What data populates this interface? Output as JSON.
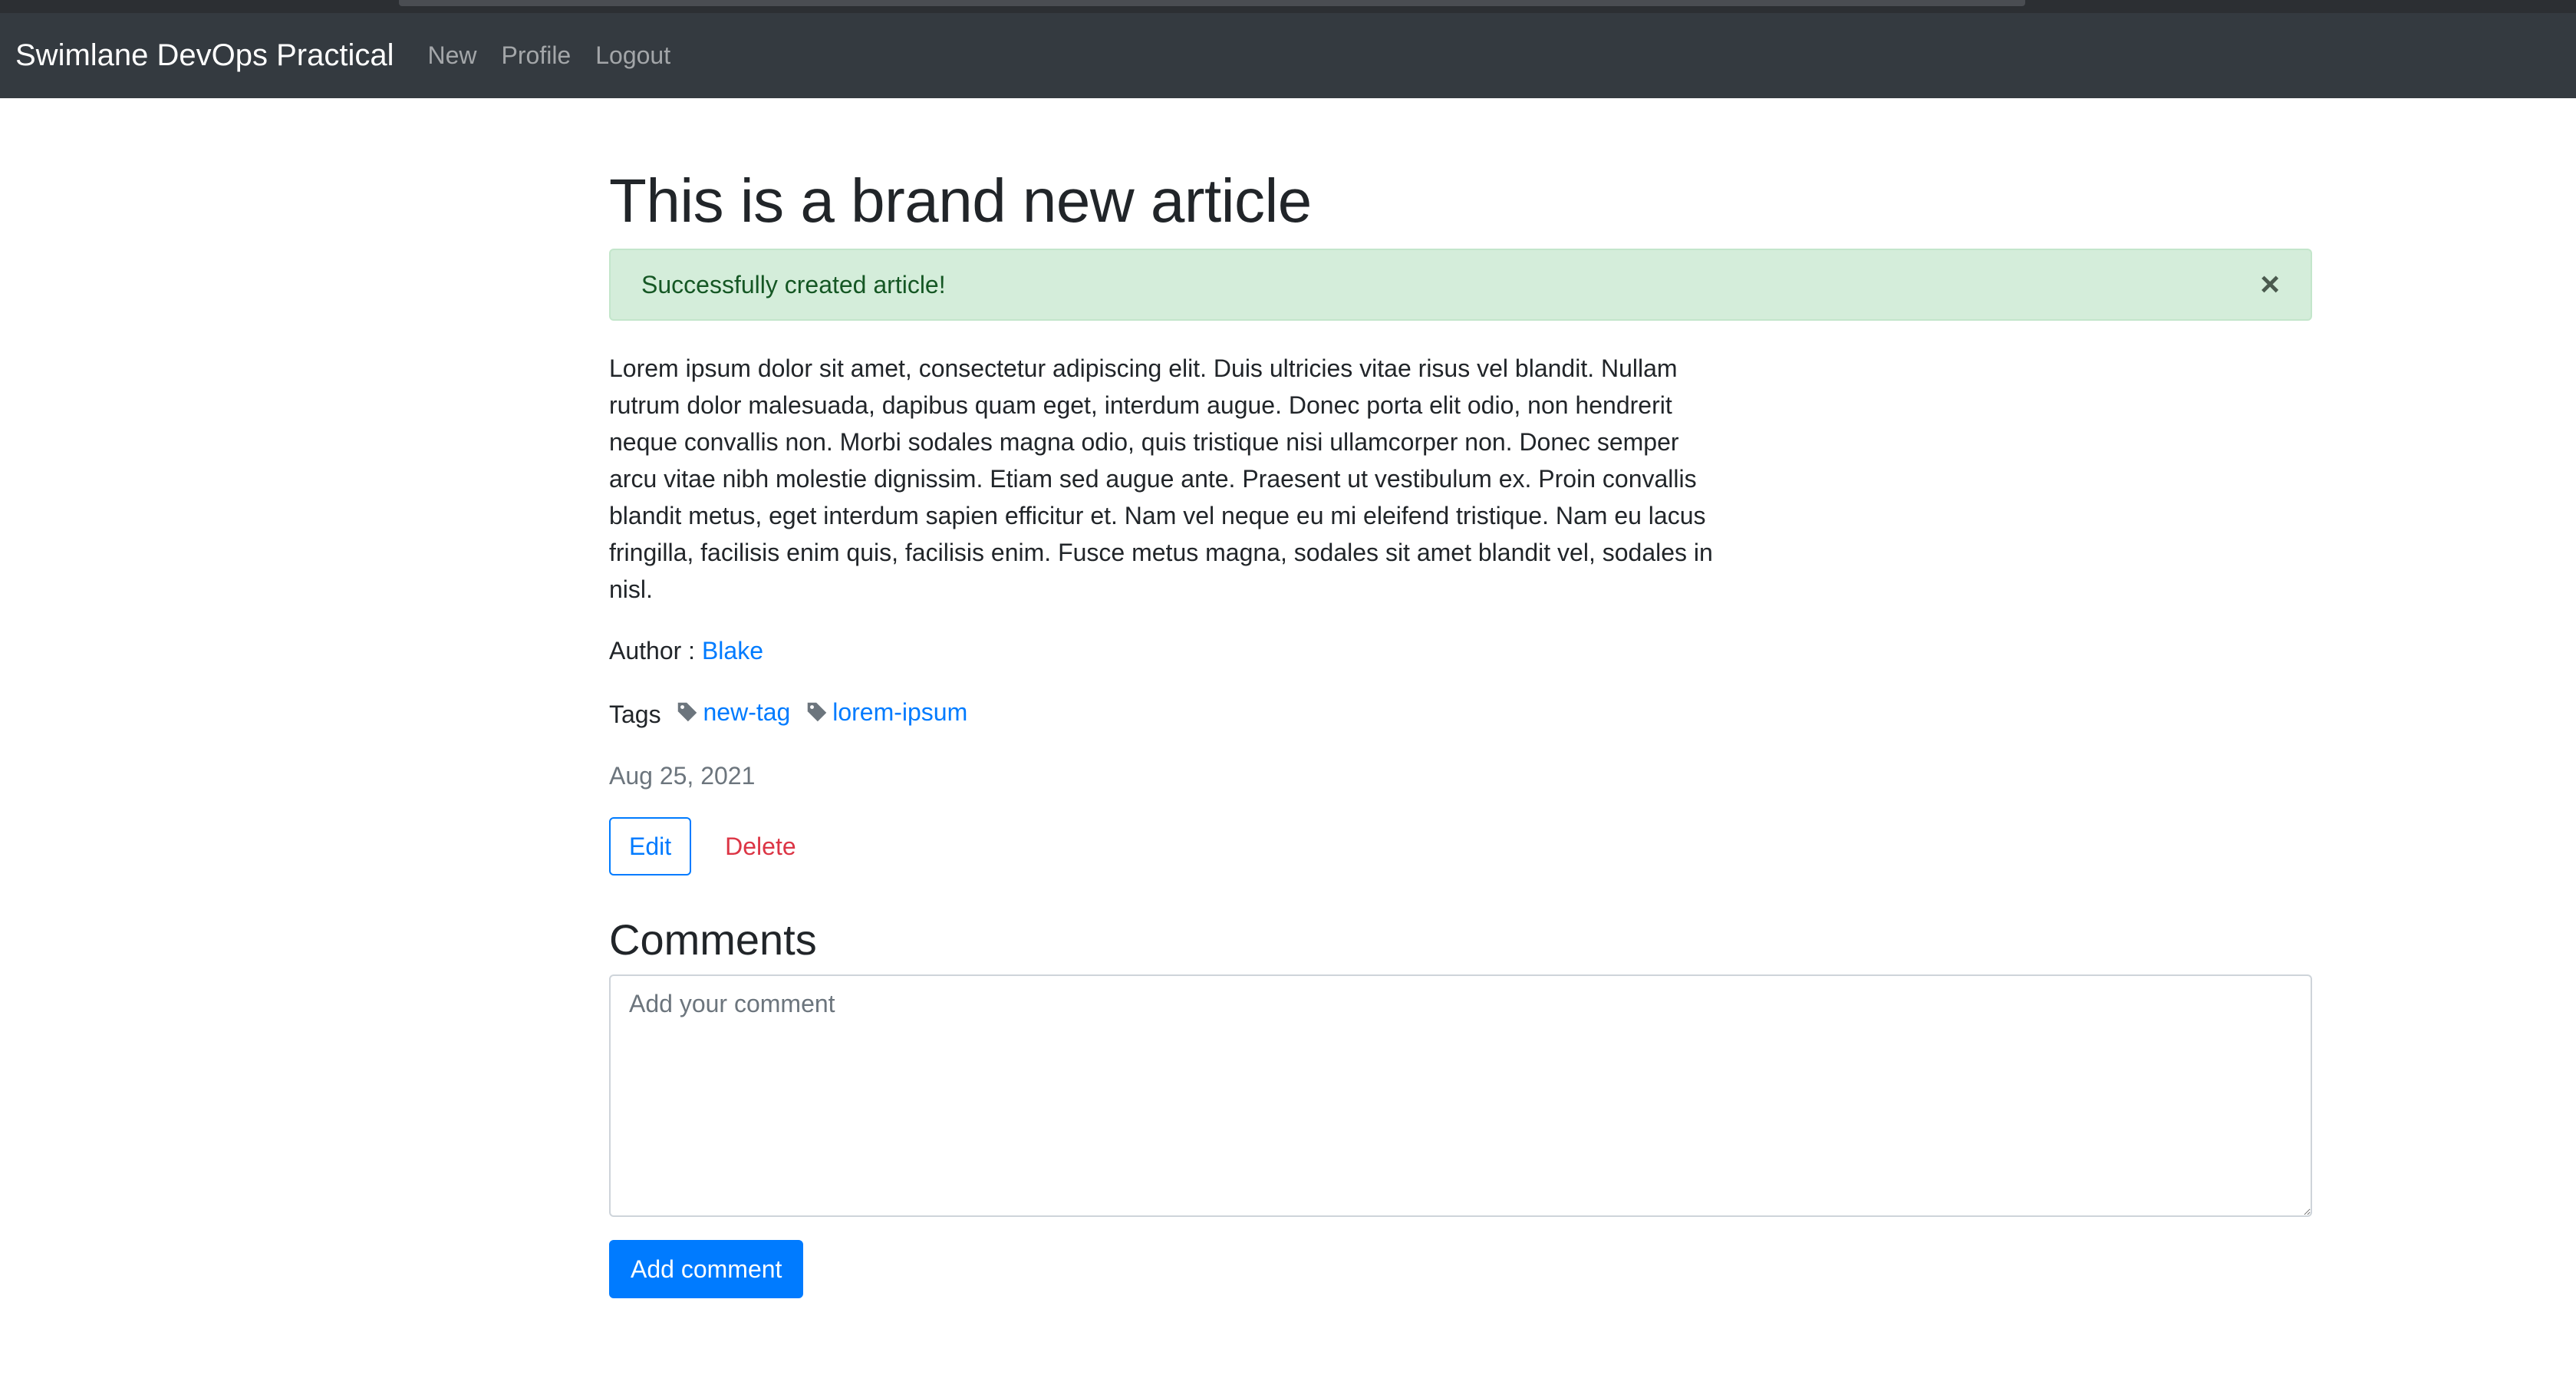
{
  "navbar": {
    "brand": "Swimlane DevOps Practical",
    "links": [
      "New",
      "Profile",
      "Logout"
    ]
  },
  "article": {
    "title": "This is a brand new article",
    "alert": "Successfully created article!",
    "alert_close": "×",
    "body": "Lorem ipsum dolor sit amet, consectetur adipiscing elit. Duis ultricies vitae risus vel blandit. Nullam rutrum dolor malesuada, dapibus quam eget, interdum augue. Donec porta elit odio, non hendrerit neque convallis non. Morbi sodales magna odio, quis tristique nisi ullamcorper non. Donec semper arcu vitae nibh molestie dignissim. Etiam sed augue ante. Praesent ut vestibulum ex. Proin convallis blandit metus, eget interdum sapien efficitur et. Nam vel neque eu mi eleifend tristique. Nam eu lacus fringilla, facilisis enim quis, facilisis enim. Fusce metus magna, sodales sit amet blandit vel, sodales in nisl.",
    "author_label": "Author :",
    "author": "Blake",
    "tags_label": "Tags",
    "tags": [
      "new-tag",
      "lorem-ipsum"
    ],
    "date": "Aug 25, 2021",
    "edit_label": "Edit",
    "delete_label": "Delete"
  },
  "comments": {
    "heading": "Comments",
    "placeholder": "Add your comment",
    "value": "",
    "submit_label": "Add comment"
  },
  "colors": {
    "navbar": "#343a40",
    "primary": "#007bff",
    "danger": "#dc3545",
    "alert_bg": "#d4edda",
    "alert_text": "#155724",
    "muted": "#6c757d"
  },
  "icons": {
    "tag": "tag-icon",
    "close": "close-icon"
  }
}
